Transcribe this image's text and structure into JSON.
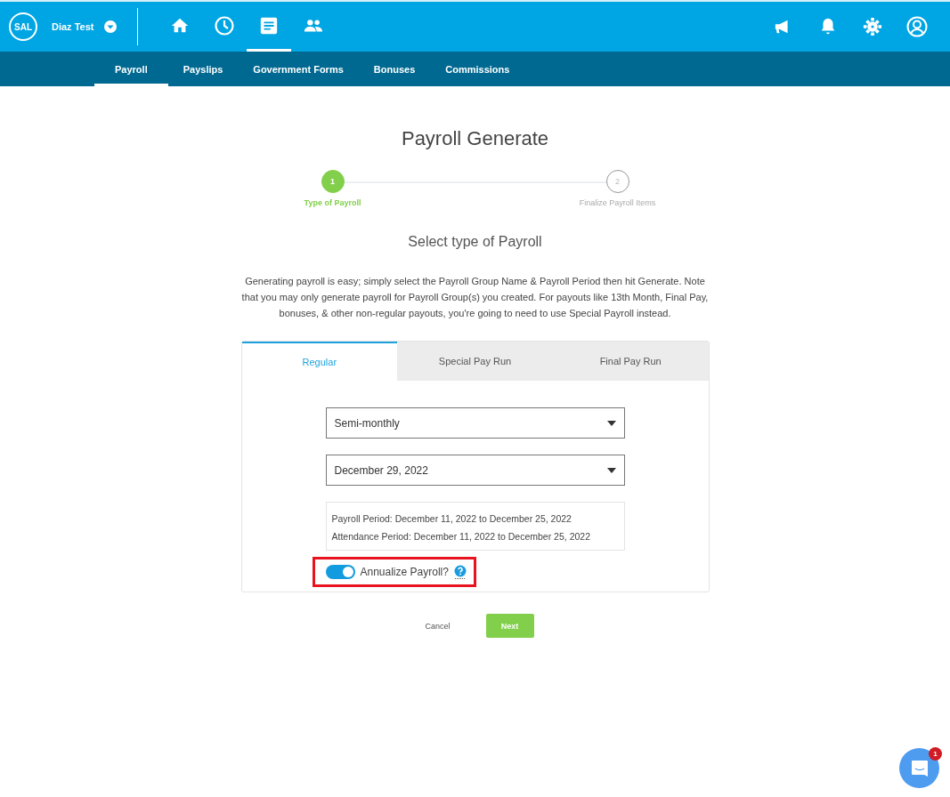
{
  "topbar": {
    "logo": "SAL",
    "company": "Diaz Test",
    "nav_icons": [
      {
        "kind": "home",
        "selected": false
      },
      {
        "kind": "clock",
        "selected": false
      },
      {
        "kind": "document",
        "selected": true
      },
      {
        "kind": "people",
        "selected": false
      }
    ],
    "right_icons": [
      {
        "kind": "megaphone"
      },
      {
        "kind": "bell"
      },
      {
        "kind": "gear"
      },
      {
        "kind": "user"
      }
    ]
  },
  "subnav": [
    {
      "label": "Payroll",
      "selected": true
    },
    {
      "label": "Payslips",
      "selected": false
    },
    {
      "label": "Government Forms",
      "selected": false
    },
    {
      "label": "Bonuses",
      "selected": false
    },
    {
      "label": "Commissions",
      "selected": false
    }
  ],
  "page_title": "Payroll Generate",
  "steps": [
    {
      "number": "1",
      "label": "Type of Payroll",
      "active": true
    },
    {
      "number": "2",
      "label": "Finalize Payroll Items",
      "active": false
    }
  ],
  "section_title": "Select type of Payroll",
  "description": "Generating payroll is easy; simply select the Payroll Group Name & Payroll Period then hit Generate. Note that you may only generate payroll for Payroll Group(s) you created. For payouts like 13th Month, Final Pay, bonuses, & other non-regular payouts, you're going to need to use Special Payroll instead.",
  "tabs": [
    {
      "label": "Regular",
      "selected": true
    },
    {
      "label": "Special Pay Run",
      "selected": false
    },
    {
      "label": "Final Pay Run",
      "selected": false
    }
  ],
  "selects": [
    {
      "value": "Semi-monthly"
    },
    {
      "value": "December 29, 2022"
    }
  ],
  "periods": [
    "Payroll Period: December 11, 2022 to December 25, 2022",
    "Attendance Period: December 11, 2022 to December 25, 2022"
  ],
  "toggle": {
    "label": "Annualize Payroll?",
    "on": true,
    "highlighted": true
  },
  "buttons": {
    "cancel": "Cancel",
    "next": "Next"
  },
  "chat": {
    "badge": "1"
  }
}
